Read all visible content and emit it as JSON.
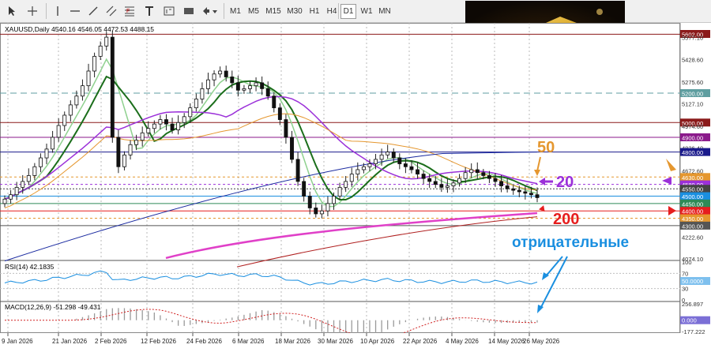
{
  "toolbar": {
    "icons": [
      "cursor-arrow-icon",
      "crosshair-icon",
      "vertical-line-icon",
      "horizontal-line-icon",
      "trend-line-icon",
      "equidistant-channel-icon",
      "fibonacci-icon",
      "text-label-icon",
      "label-tool-icon",
      "rectangle-shape-icon",
      "arrow-tools-icon"
    ],
    "timeframes": [
      "M1",
      "M5",
      "M15",
      "M30",
      "H1",
      "H4",
      "D1",
      "W1",
      "MN"
    ],
    "active_timeframe": "D1"
  },
  "chart": {
    "header": "XAUUSD,Daily  4540.16 4546.05 4472.53 4488.15",
    "price_axis_labels": [
      "5602.00",
      "5577.10",
      "5428.60",
      "5275.60",
      "5200.00",
      "5127.10",
      "5000.00",
      "4974.60",
      "4900.00",
      "4826.40",
      "4800.00",
      "4672.60",
      "4630.00",
      "4580.00",
      "4550.00",
      "4500.00",
      "4450.00",
      "4400.00",
      "4350.00",
      "4300.00",
      "4222.60",
      "4074.10"
    ],
    "date_labels": [
      "9 Jan 2026",
      "21 Jan 2026",
      "2 Feb 2026",
      "12 Feb 2026",
      "24 Feb 2026",
      "6 Mar 2026",
      "18 Mar 2026",
      "30 Mar 2026",
      "10 Apr 2026",
      "22 Apr 2026",
      "4 May 2026",
      "14 May 2026",
      "26 May 2026"
    ],
    "annotations": {
      "ma50": "50",
      "ma20": "20",
      "ma200": "200",
      "negative": "отрицательные"
    }
  },
  "rsi": {
    "label": "RSI(14) 42.1835",
    "axis": [
      "100",
      "70",
      "50.0000",
      "30",
      "0"
    ]
  },
  "macd": {
    "label": "MACD(12,26,9) -51.298 -49.431",
    "axis": [
      "256.897",
      "0.000",
      "-177.222"
    ]
  },
  "colors": {
    "ma50": "#e5972f",
    "ma20": "#9b30d9",
    "ma200": "#e61e1e",
    "negative": "#1a8fe0",
    "bull_candle": "#1b6e1b",
    "bear_candle": "#d9534f"
  },
  "chart_data": {
    "type": "candlestick",
    "symbol": "XAUUSD",
    "timeframe": "Daily",
    "ohlc_last": {
      "open": 4540.16,
      "high": 4546.05,
      "low": 4472.53,
      "close": 4488.15
    },
    "x_range": [
      "9 Jan 2026",
      "26 May 2026"
    ],
    "y_range": [
      4074.1,
      5602.0
    ],
    "closes": [
      4480,
      4510,
      4560,
      4600,
      4640,
      4700,
      4760,
      4820,
      4900,
      4980,
      5050,
      5120,
      5180,
      5250,
      5350,
      5450,
      5520,
      5580,
      4900,
      4700,
      4780,
      4850,
      4880,
      4930,
      4960,
      4990,
      5020,
      4990,
      4950,
      5000,
      5040,
      5100,
      5160,
      5230,
      5290,
      5330,
      5350,
      5310,
      5270,
      5220,
      5230,
      5250,
      5270,
      5230,
      5180,
      5100,
      5020,
      4900,
      4750,
      4600,
      4500,
      4420,
      4380,
      4400,
      4450,
      4500,
      4560,
      4600,
      4650,
      4680,
      4700,
      4720,
      4750,
      4780,
      4800,
      4760,
      4720,
      4700,
      4680,
      4650,
      4620,
      4600,
      4580,
      4560,
      4570,
      4590,
      4620,
      4660,
      4680,
      4660,
      4640,
      4620,
      4600,
      4570,
      4550,
      4540,
      4530,
      4520,
      4510,
      4490
    ],
    "horizontal_levels": [
      5600,
      5200,
      5000,
      4900,
      4800,
      4630,
      4580,
      4550,
      4500,
      4450,
      4400,
      4350,
      4300
    ],
    "moving_averages": [
      "MA 20",
      "MA 50",
      "MA 200"
    ]
  }
}
